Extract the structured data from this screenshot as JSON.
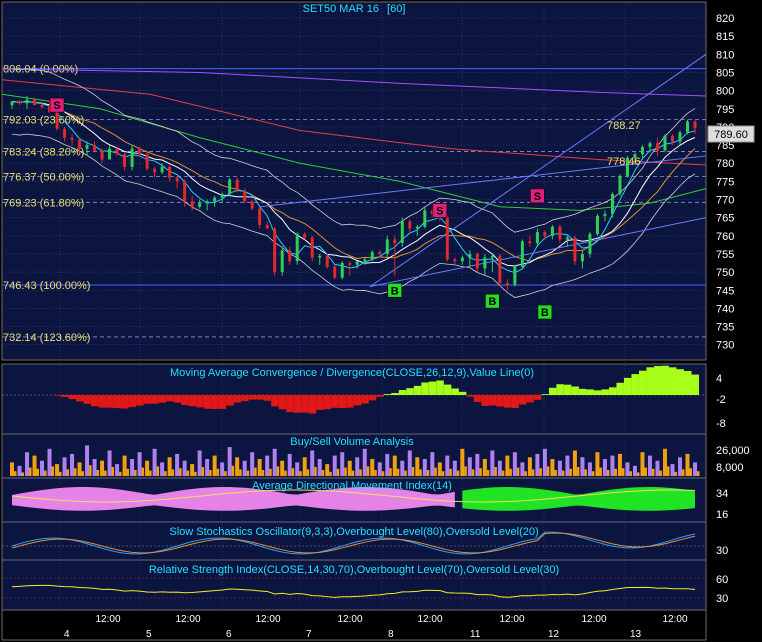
{
  "colors": {
    "bg": "#0b1540",
    "axis_bg": "#000000",
    "grid": "#3b4a8a",
    "up": "#2fd05a",
    "down": "#e22a2a",
    "text": "#22e0ff",
    "fib_text": "#e8e06a",
    "purple": "#a050ff",
    "white": "#e0e0e0",
    "green_ma": "#33cc33",
    "red_ma": "#e04040",
    "orange_ma": "#e09030",
    "blue_line": "#6a7cff",
    "macd_neg": "#e01818",
    "macd_pos": "#a8ff18",
    "vol_purple": "#b080f0",
    "vol_orange": "#f0a010",
    "adx_pink": "#f088f0",
    "adx_green": "#22ee22",
    "sto_blue": "#2aa0ff",
    "sto_orange": "#e09030",
    "rsi": "#f0f020",
    "sell_badge": "#e0207a",
    "buy_badge": "#22dd22"
  },
  "header": {
    "title": "SET50 MAR 16",
    "interval": "[60]"
  },
  "chart_data": [
    {
      "type": "candlestick",
      "title": "SET50 MAR 16  [60]",
      "ylim": [
        725,
        825
      ],
      "y_ticks": [
        820,
        815,
        810,
        805,
        800,
        795,
        790,
        785,
        780,
        775,
        770,
        765,
        760,
        755,
        750,
        745,
        740,
        735,
        730
      ],
      "last_price": "789.60",
      "fib_levels": [
        {
          "label": "806.04 (0.00%)",
          "value": 806.04
        },
        {
          "label": "792.03 (23.60%)",
          "value": 792.03
        },
        {
          "label": "783.24 (38.20%)",
          "value": 783.24
        },
        {
          "label": "776.37 (50.00%)",
          "value": 776.37
        },
        {
          "label": "769.23 (61.80%)",
          "value": 769.23
        },
        {
          "label": "746.43 (100.00%)",
          "value": 746.43
        },
        {
          "label": "732.14 (123.60%)",
          "value": 732.14
        }
      ],
      "annotations": [
        {
          "text": "788.27",
          "value": 788.27
        },
        {
          "text": "778.46",
          "value": 778.46
        }
      ],
      "signals": [
        {
          "text": "S",
          "kind": "sell",
          "bar": 6,
          "price": 796
        },
        {
          "text": "S",
          "kind": "sell",
          "bar": 57,
          "price": 767
        },
        {
          "text": "S",
          "kind": "sell",
          "bar": 70,
          "price": 771
        },
        {
          "text": "B",
          "kind": "buy",
          "bar": 51,
          "price": 745
        },
        {
          "text": "B",
          "kind": "buy",
          "bar": 64,
          "price": 742
        },
        {
          "text": "B",
          "kind": "buy",
          "bar": 71,
          "price": 739
        }
      ],
      "candles": [
        [
          796,
          797,
          795,
          797
        ],
        [
          797,
          797.5,
          796,
          796.5
        ],
        [
          796.5,
          798.5,
          795,
          797.5
        ],
        [
          797.5,
          798,
          796,
          796
        ],
        [
          796,
          797,
          795,
          795.5
        ],
        [
          795.5,
          797,
          794,
          794
        ],
        [
          794,
          795,
          789,
          789.5
        ],
        [
          789.5,
          790,
          786,
          787
        ],
        [
          787,
          788,
          785,
          786.5
        ],
        [
          786.5,
          787,
          783,
          784
        ],
        [
          784,
          786,
          782,
          785
        ],
        [
          785,
          786,
          783,
          783.5
        ],
        [
          783.5,
          784,
          780,
          781
        ],
        [
          781,
          785,
          781,
          784
        ],
        [
          784,
          784.5,
          782,
          782.5
        ],
        [
          782.5,
          783,
          778,
          779
        ],
        [
          779,
          785,
          778,
          784
        ],
        [
          784,
          784.5,
          782,
          782.5
        ],
        [
          782.5,
          783,
          778,
          778.5
        ],
        [
          778.5,
          779,
          776,
          777.5
        ],
        [
          777.5,
          780,
          777,
          779
        ],
        [
          779,
          779.5,
          775,
          776
        ],
        [
          776,
          776.5,
          773,
          775
        ],
        [
          775,
          775.5,
          768,
          769.5
        ],
        [
          769.5,
          771,
          767,
          768
        ],
        [
          768,
          770,
          767.5,
          769
        ],
        [
          769,
          770,
          767,
          769.5
        ],
        [
          769.5,
          771,
          768,
          770.5
        ],
        [
          770.5,
          772,
          769,
          771.5
        ],
        [
          771.5,
          776,
          771,
          775.5
        ],
        [
          775.5,
          776,
          772,
          772.5
        ],
        [
          772.5,
          773,
          769,
          769.5
        ],
        [
          769.5,
          770,
          767,
          767.5
        ],
        [
          767.5,
          768,
          762,
          763
        ],
        [
          763,
          764,
          762,
          762
        ],
        [
          762,
          762.5,
          749,
          750
        ],
        [
          750,
          757,
          749,
          756
        ],
        [
          756,
          757,
          752,
          753
        ],
        [
          753,
          761,
          752,
          760.5
        ],
        [
          760.5,
          761,
          759,
          759.5
        ],
        [
          759.5,
          760,
          753,
          754
        ],
        [
          754,
          755,
          752,
          754.5
        ],
        [
          754.5,
          755,
          751,
          751.5
        ],
        [
          751.5,
          752,
          748,
          748.5
        ],
        [
          748.5,
          753,
          748,
          752.5
        ],
        [
          752.5,
          753,
          749,
          752
        ],
        [
          752,
          753,
          751,
          753
        ],
        [
          753,
          754,
          752,
          753.5
        ],
        [
          753.5,
          756,
          753,
          755.5
        ],
        [
          755.5,
          756,
          754,
          755
        ],
        [
          755,
          760,
          754,
          759
        ],
        [
          759,
          760,
          749,
          758
        ],
        [
          758,
          765,
          757,
          764
        ],
        [
          764,
          764.5,
          761,
          762
        ],
        [
          762,
          763,
          760,
          762.5
        ],
        [
          762.5,
          768,
          762,
          767
        ],
        [
          767,
          767.5,
          765,
          766
        ],
        [
          766,
          767,
          764,
          765
        ],
        [
          765,
          765.5,
          753,
          753.5
        ],
        [
          753.5,
          754,
          752,
          753
        ],
        [
          753,
          754.5,
          752,
          754
        ],
        [
          754,
          756,
          751,
          755
        ],
        [
          755,
          755.5,
          750,
          751
        ],
        [
          751,
          755,
          749,
          754
        ],
        [
          754,
          755,
          750,
          754.5
        ],
        [
          754.5,
          755,
          746,
          747
        ],
        [
          747,
          748,
          745,
          746.5
        ],
        [
          746.5,
          752,
          746,
          751.5
        ],
        [
          751.5,
          759,
          751,
          758.5
        ],
        [
          758.5,
          760,
          757,
          758
        ],
        [
          758,
          762,
          757,
          761
        ],
        [
          761,
          761.5,
          759,
          760
        ],
        [
          760,
          763,
          759,
          762.5
        ],
        [
          762.5,
          763,
          758,
          759
        ],
        [
          759,
          760,
          757,
          759.5
        ],
        [
          759.5,
          760,
          752,
          753
        ],
        [
          753,
          756,
          751,
          755
        ],
        [
          755,
          761,
          754,
          760.5
        ],
        [
          760.5,
          766,
          760,
          765.5
        ],
        [
          765.5,
          767,
          764,
          766
        ],
        [
          766,
          772,
          765,
          771.5
        ],
        [
          771.5,
          777,
          771,
          776.5
        ],
        [
          776.5,
          782,
          776,
          781.5
        ],
        [
          781.5,
          783,
          780,
          782.5
        ],
        [
          782.5,
          785,
          781,
          784.5
        ],
        [
          784.5,
          786,
          783,
          785.5
        ],
        [
          785.5,
          787,
          782,
          783.5
        ],
        [
          783.5,
          788,
          783,
          787.5
        ],
        [
          787.5,
          788,
          785,
          786
        ],
        [
          786,
          789,
          785,
          788.5
        ],
        [
          788.5,
          792,
          788,
          791.5
        ],
        [
          791.5,
          792,
          788,
          789.6
        ]
      ]
    },
    {
      "type": "bar",
      "title": "Moving Average Convergence / Divergence(CLOSE,26,12,9),Value Line(0)",
      "ylim": [
        -10,
        6
      ],
      "y_ticks": [
        "4",
        "-2",
        "-8"
      ]
    },
    {
      "type": "bar",
      "title": "Buy/Sell Volume Analysis",
      "y_ticks": [
        "26,000",
        "8,000"
      ]
    },
    {
      "type": "area",
      "title": "Average Directional Movement Index(14)",
      "y_ticks": [
        "34",
        "16"
      ]
    },
    {
      "type": "line",
      "title": "Slow Stochastics Oscillator(9,3,3),Overbought Level(80),Oversold Level(20)",
      "y_ticks": [
        "30"
      ]
    },
    {
      "type": "line",
      "title": "Relative Strength Index(CLOSE,14,30,70),Overbought Level(70),Oversold Level(30)",
      "y_ticks": [
        "60",
        "30"
      ]
    }
  ],
  "x_axis": {
    "time_labels": [
      "12:00",
      "12:00",
      "12:00",
      "12:00",
      "12:00",
      "12:00",
      "12:00",
      "12:00"
    ],
    "day_labels": [
      "4",
      "5",
      "7",
      "8",
      "11",
      "12",
      "13"
    ],
    "day_labels_extra": [
      "6"
    ]
  }
}
